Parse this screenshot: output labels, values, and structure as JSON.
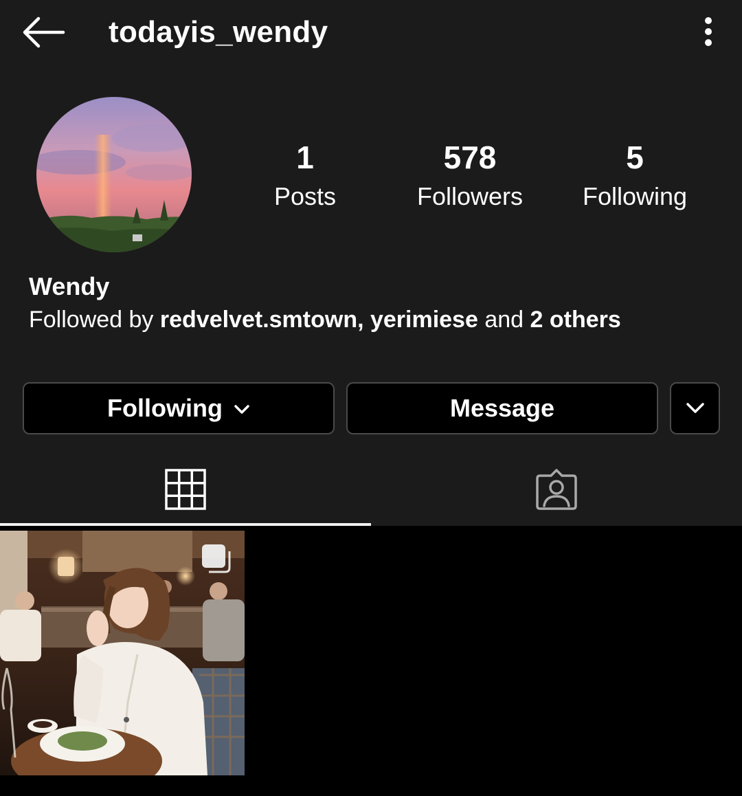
{
  "header": {
    "username": "todayis_wendy"
  },
  "stats": {
    "posts_count": "1",
    "posts_label": "Posts",
    "followers_count": "578",
    "followers_label": "Followers",
    "following_count": "5",
    "following_label": "Following"
  },
  "profile": {
    "display_name": "Wendy",
    "followed_by_prefix": "Followed by ",
    "followed_by_names": "redvelvet.smtown, yerimiese",
    "followed_by_joiner": " and ",
    "followed_by_others": "2 others"
  },
  "actions": {
    "following_label": "Following",
    "message_label": "Message"
  },
  "icons": {
    "back": "arrow-left-icon",
    "more": "more-vertical-icon",
    "following_dropdown": "chevron-down-icon",
    "suggest": "chevron-down-icon",
    "grid_tab": "grid-icon",
    "tagged_tab": "tagged-person-icon",
    "multi_post": "carousel-icon"
  },
  "colors": {
    "top_background": "#1b1b1b",
    "page_background": "#000000",
    "button_border": "#4a4a4a",
    "text": "#ffffff"
  }
}
